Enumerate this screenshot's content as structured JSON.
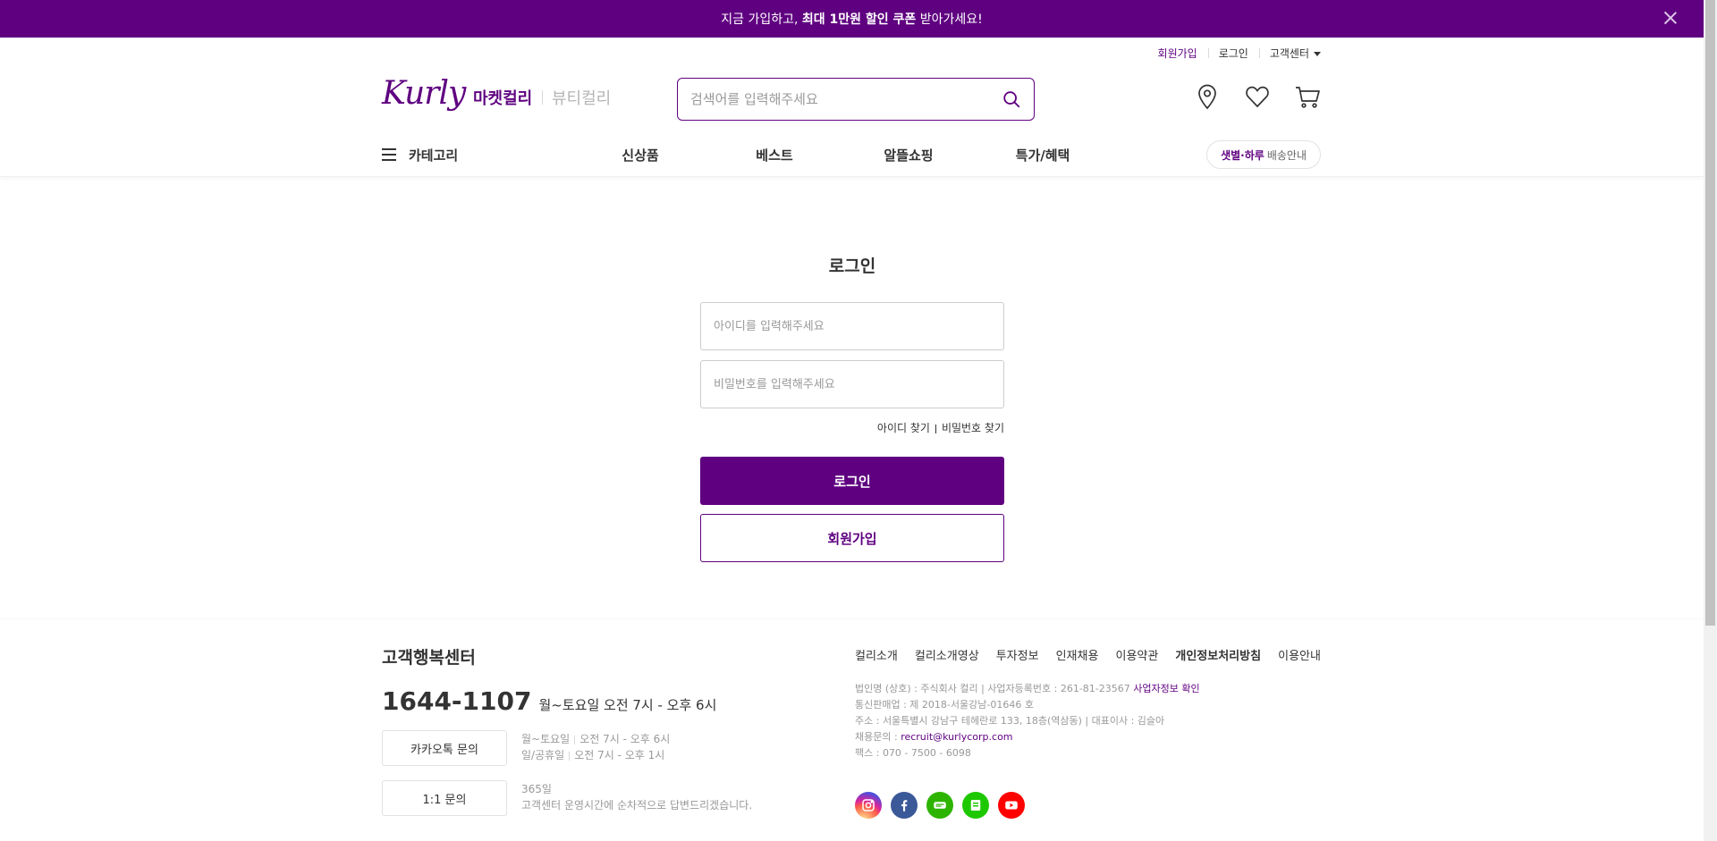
{
  "promo": {
    "text_before": "지금 가입하고, ",
    "text_bold": "최대 1만원 할인 쿠폰",
    "text_after": " 받아가세요!"
  },
  "util": {
    "join": "회원가입",
    "login": "로그인",
    "customer_center": "고객센터"
  },
  "logo": {
    "text": "Kurly",
    "market_tab": "마켓컬리",
    "beauty_tab": "뷰티컬리"
  },
  "search": {
    "placeholder": "검색어를 입력해주세요"
  },
  "gnb": {
    "category": "카테고리",
    "items": [
      "신상품",
      "베스트",
      "알뜰쇼핑",
      "특가/혜택"
    ],
    "delivery_bold": "샛별·하루",
    "delivery_text": "배송안내"
  },
  "login": {
    "title": "로그인",
    "id_placeholder": "아이디를 입력해주세요",
    "pw_placeholder": "비밀번호를 입력해주세요",
    "find_id": "아이디 찾기",
    "find_pw": "비밀번호 찾기",
    "login_button": "로그인",
    "join_button": "회원가입"
  },
  "footer": {
    "title": "고객행복센터",
    "phone": "1644-1107",
    "phone_hours": "월~토요일 오전 7시 - 오후 6시",
    "kakao_button": "카카오톡 문의",
    "kakao_line1_a": "월~토요일",
    "kakao_line1_b": "오전 7시 - 오후 6시",
    "kakao_line2_a": "일/공휴일",
    "kakao_line2_b": "오전 7시 - 오후 1시",
    "oneone_button": "1:1 문의",
    "oneone_line1": "365일",
    "oneone_line2": "고객센터 운영시간에 순차적으로 답변드리겠습니다.",
    "links": [
      "컬리소개",
      "컬리소개영상",
      "투자정보",
      "인재채용",
      "이용약관",
      "개인정보처리방침",
      "이용안내"
    ],
    "info_line1": "법인명 (상호) : 주식회사 컬리 | 사업자등록번호 : 261-81-23567",
    "info_biz_link": "사업자정보 확인",
    "info_line2": "통신판매업 : 제 2018-서울강남-01646 호",
    "info_line3": "주소 : 서울특별시 강남구 테헤란로 133, 18층(역삼동) | 대표이사 : 김슬아",
    "info_line4_label": "채용문의 : ",
    "info_line4_email": "recruit@kurlycorp.com",
    "info_line5": "팩스 : 070 - 7500 - 6098",
    "sns": [
      "instagram-icon",
      "facebook-icon",
      "blog-icon",
      "naver-post-icon",
      "youtube-icon"
    ]
  },
  "colors": {
    "brand": "#5f0080",
    "text": "#333333",
    "muted": "#999999"
  }
}
